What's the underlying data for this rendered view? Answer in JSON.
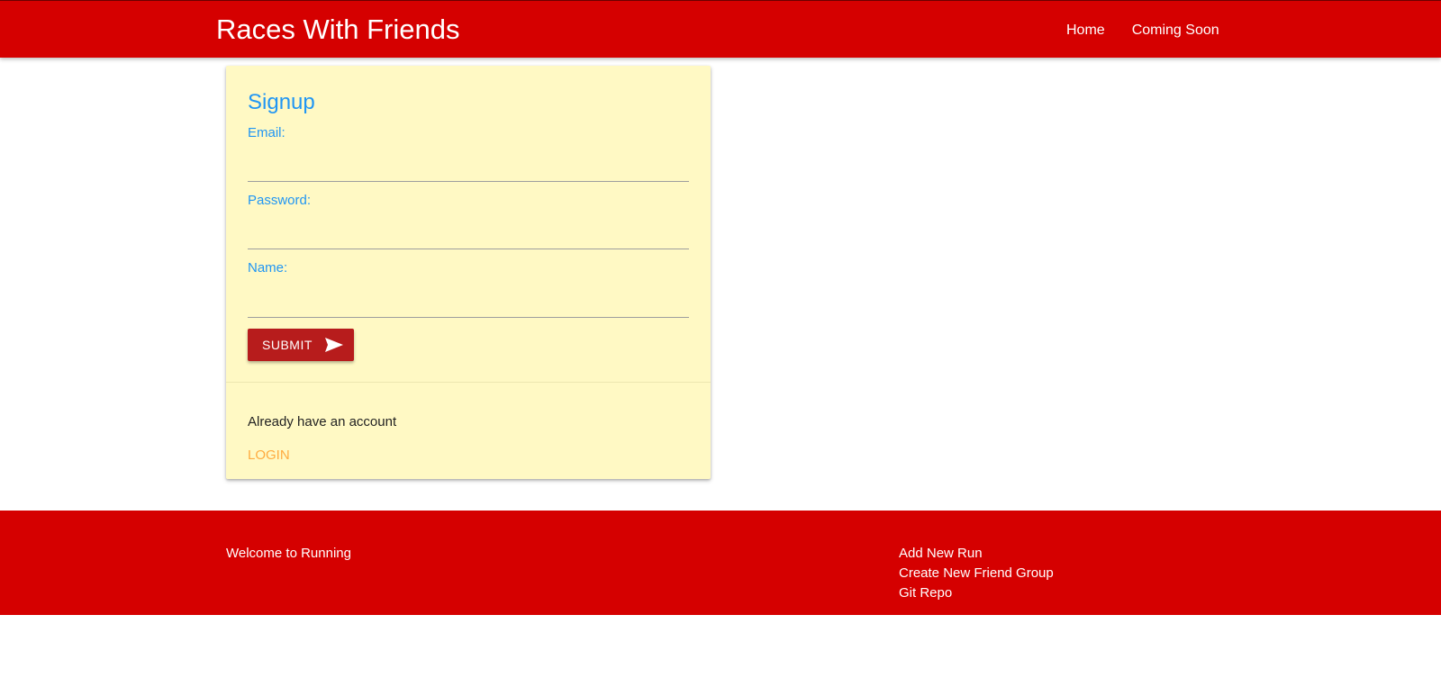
{
  "navbar": {
    "brand": "Races With Friends",
    "links": [
      "Home",
      "Coming Soon"
    ]
  },
  "signup_card": {
    "title": "Signup",
    "fields": {
      "email": {
        "label": "Email:",
        "value": ""
      },
      "password": {
        "label": "Password:",
        "value": ""
      },
      "name": {
        "label": "Name:",
        "value": ""
      }
    },
    "submit_label": "SUBMIT",
    "submit_icon": "send-icon",
    "account_prompt": "Already have an account",
    "login_label": "LOGIN"
  },
  "footer": {
    "welcome": "Welcome to Running",
    "links": [
      "Add New Run",
      "Create New Friend Group",
      "Git Repo"
    ]
  },
  "colors": {
    "navbar_bg": "#d50000",
    "card_bg": "#fff9c4",
    "accent_blue": "#2196f3",
    "button_bg": "#b71c1c",
    "login_link": "#ffab40"
  }
}
